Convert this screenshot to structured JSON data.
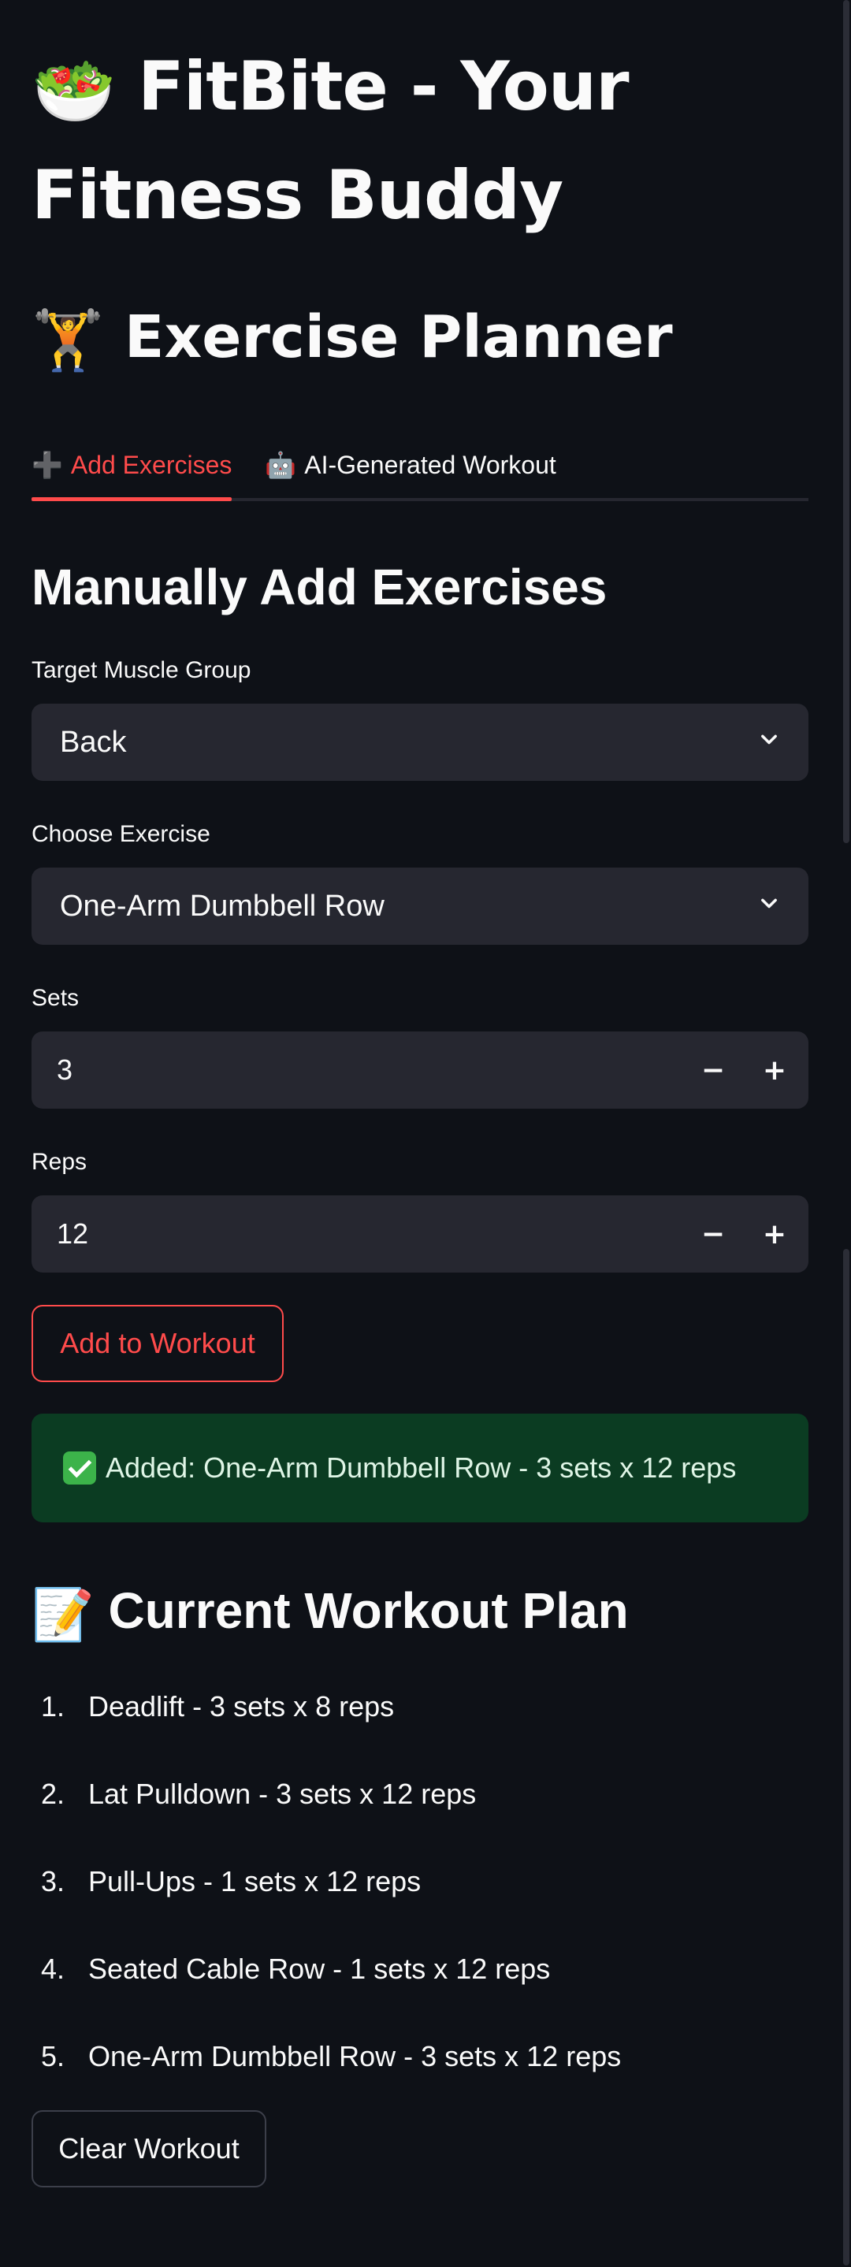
{
  "app": {
    "title": "FitBite - Your Fitness Buddy",
    "title_emoji": "🥗"
  },
  "section": {
    "title": "Exercise Planner",
    "title_emoji": "🏋️"
  },
  "tabs": [
    {
      "label": "Add Exercises",
      "glyph": "➕",
      "active": true
    },
    {
      "label": "AI-Generated Workout",
      "glyph": "🤖",
      "active": false
    }
  ],
  "manual": {
    "heading": "Manually Add Exercises",
    "muscle_label": "Target Muscle Group",
    "muscle_value": "Back",
    "exercise_label": "Choose Exercise",
    "exercise_value": "One-Arm Dumbbell Row",
    "sets_label": "Sets",
    "sets_value": "3",
    "reps_label": "Reps",
    "reps_value": "12",
    "stepper_minus": "−",
    "stepper_plus": "+",
    "add_button": "Add to Workout"
  },
  "alert": {
    "text": "Added: One-Arm Dumbbell Row - 3 sets x 12 reps"
  },
  "plan": {
    "heading": "Current Workout Plan",
    "heading_emoji": "📝",
    "items": [
      {
        "num": "1.",
        "text": "Deadlift - 3 sets x 8 reps"
      },
      {
        "num": "2.",
        "text": "Lat Pulldown - 3 sets x 12 reps"
      },
      {
        "num": "3.",
        "text": "Pull-Ups - 1 sets x 12 reps"
      },
      {
        "num": "4.",
        "text": "Seated Cable Row - 1 sets x 12 reps"
      },
      {
        "num": "5.",
        "text": "One-Arm Dumbbell Row - 3 sets x 12 reps"
      }
    ],
    "clear_button": "Clear Workout"
  },
  "colors": {
    "background": "#0e1117",
    "accent": "#ff4b4b",
    "input_bg": "#262730",
    "success_bg": "#0b3c22"
  }
}
